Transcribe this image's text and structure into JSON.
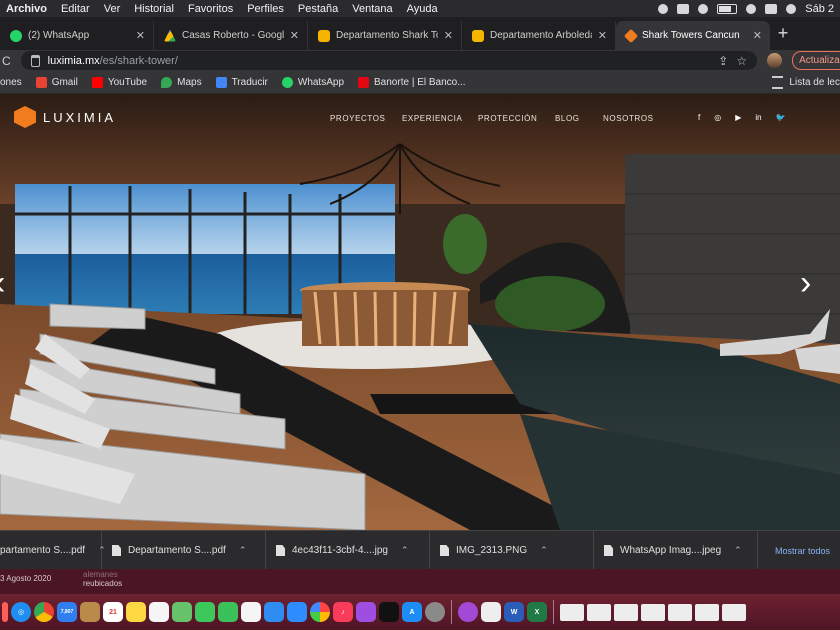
{
  "menubar": {
    "items": [
      "Archivo",
      "Editar",
      "Ver",
      "Historial",
      "Favoritos",
      "Perfiles",
      "Pestaña",
      "Ventana",
      "Ayuda"
    ],
    "clock": "Sáb 2"
  },
  "tabs": [
    {
      "label": "(2) WhatsApp",
      "icon": "whatsapp-icon"
    },
    {
      "label": "Casas Roberto - Google Dri",
      "icon": "google-drive-icon"
    },
    {
      "label": "Departamento Shark Tower",
      "icon": "document-icon"
    },
    {
      "label": "Departamento Arboleda - P",
      "icon": "document-icon"
    },
    {
      "label": "Shark Towers Cancun",
      "icon": "luximia-icon",
      "active": true
    }
  ],
  "address": {
    "domain": "luximia.mx",
    "path": "/es/shark-tower/",
    "update_label": "Actualizar"
  },
  "bookmarks": {
    "items": [
      {
        "label": "ones",
        "color": "#00000000"
      },
      {
        "label": "Gmail",
        "color": "#ea4335"
      },
      {
        "label": "YouTube",
        "color": "#ff0000"
      },
      {
        "label": "Maps",
        "color": "#34a853"
      },
      {
        "label": "Traducir",
        "color": "#4285f4"
      },
      {
        "label": "WhatsApp",
        "color": "#25d366"
      },
      {
        "label": "Banorte | El Banco...",
        "color": "#e30613"
      }
    ],
    "reading_list": "Lista de lec"
  },
  "site": {
    "brand": "LUXIMIA",
    "nav": [
      "PROYECTOS",
      "EXPERIENCIA",
      "PROTECCIÓN",
      "BLOG",
      "NOSOTROS"
    ],
    "social": [
      "f",
      "◎",
      "▶",
      "in",
      "🐦"
    ]
  },
  "downloads": {
    "items": [
      "partamento S....pdf",
      "Departamento S....pdf",
      "4ec43f11-3cbf-4....jpg",
      "IMG_2313.PNG",
      "WhatsApp Imag....jpeg"
    ],
    "show_all": "Mostrar todos"
  },
  "page_bottom": {
    "date": "3 Agosto 2020",
    "tag_top": "alemanes",
    "tag": "reubicados"
  },
  "dock": {
    "calendar_day": "21",
    "mail_badge": "7,807"
  }
}
